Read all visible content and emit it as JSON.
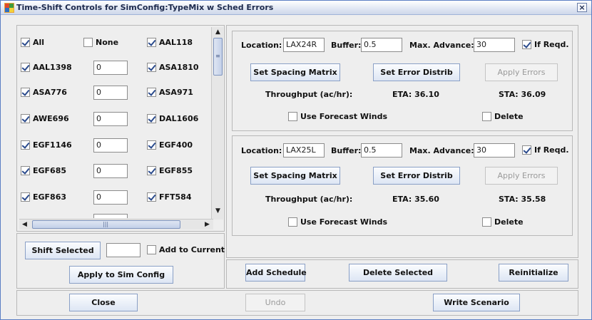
{
  "window": {
    "title": "Time-Shift Controls for SimConfig:TypeMix w Sched Errors",
    "close_glyph": "×"
  },
  "flights": {
    "select_all_label": "All",
    "select_none_label": "None",
    "items": [
      {
        "name": "AAL118",
        "checked": true,
        "value": null
      },
      {
        "name": "AAL1398",
        "checked": true,
        "value": "0"
      },
      {
        "name": "ASA1810",
        "checked": true,
        "value": null
      },
      {
        "name": "ASA776",
        "checked": true,
        "value": "0"
      },
      {
        "name": "ASA971",
        "checked": true,
        "value": null
      },
      {
        "name": "AWE696",
        "checked": true,
        "value": "0"
      },
      {
        "name": "DAL1606",
        "checked": true,
        "value": null
      },
      {
        "name": "EGF1146",
        "checked": true,
        "value": "0"
      },
      {
        "name": "EGF400",
        "checked": true,
        "value": null
      },
      {
        "name": "EGF685",
        "checked": true,
        "value": "0"
      },
      {
        "name": "EGF855",
        "checked": true,
        "value": null
      },
      {
        "name": "EGF863",
        "checked": true,
        "value": "0"
      },
      {
        "name": "FFT584",
        "checked": true,
        "value": null
      }
    ]
  },
  "left_controls": {
    "shift_selected_label": "Shift Selected",
    "shift_value": "",
    "add_to_current_label": "Add to Current",
    "apply_label": "Apply to Sim Config"
  },
  "schedules": [
    {
      "location_label": "Location:",
      "location_value": "LAX24R",
      "buffer_label": "Buffer:",
      "buffer_value": "0.5",
      "max_advance_label": "Max. Advance:",
      "max_advance_value": "30",
      "if_reqd_label": "If Reqd.",
      "spacing_label": "Set Spacing Matrix",
      "error_label": "Set Error Distrib",
      "apply_errors_label": "Apply Errors",
      "throughput_label": "Throughput (ac/hr):",
      "eta": "ETA: 36.10",
      "sta": "STA: 36.09",
      "forecast_label": "Use Forecast Winds",
      "delete_label": "Delete"
    },
    {
      "location_label": "Location:",
      "location_value": "LAX25L",
      "buffer_label": "Buffer:",
      "buffer_value": "0.5",
      "max_advance_label": "Max. Advance:",
      "max_advance_value": "30",
      "if_reqd_label": "If Reqd.",
      "spacing_label": "Set Spacing Matrix",
      "error_label": "Set Error Distrib",
      "apply_errors_label": "Apply Errors",
      "throughput_label": "Throughput (ac/hr):",
      "eta": "ETA: 35.60",
      "sta": "STA: 35.58",
      "forecast_label": "Use Forecast Winds",
      "delete_label": "Delete"
    }
  ],
  "right_buttons": {
    "add_schedule": "Add Schedule",
    "delete_selected": "Delete Selected",
    "reinitialize": "Reinitialize"
  },
  "bottom": {
    "close": "Close",
    "undo": "Undo",
    "write": "Write Scenario"
  },
  "colors": {
    "accent": "#2a4a8c",
    "window_border": "#5b7fc4",
    "disabled_text": "#9a9a9a"
  }
}
